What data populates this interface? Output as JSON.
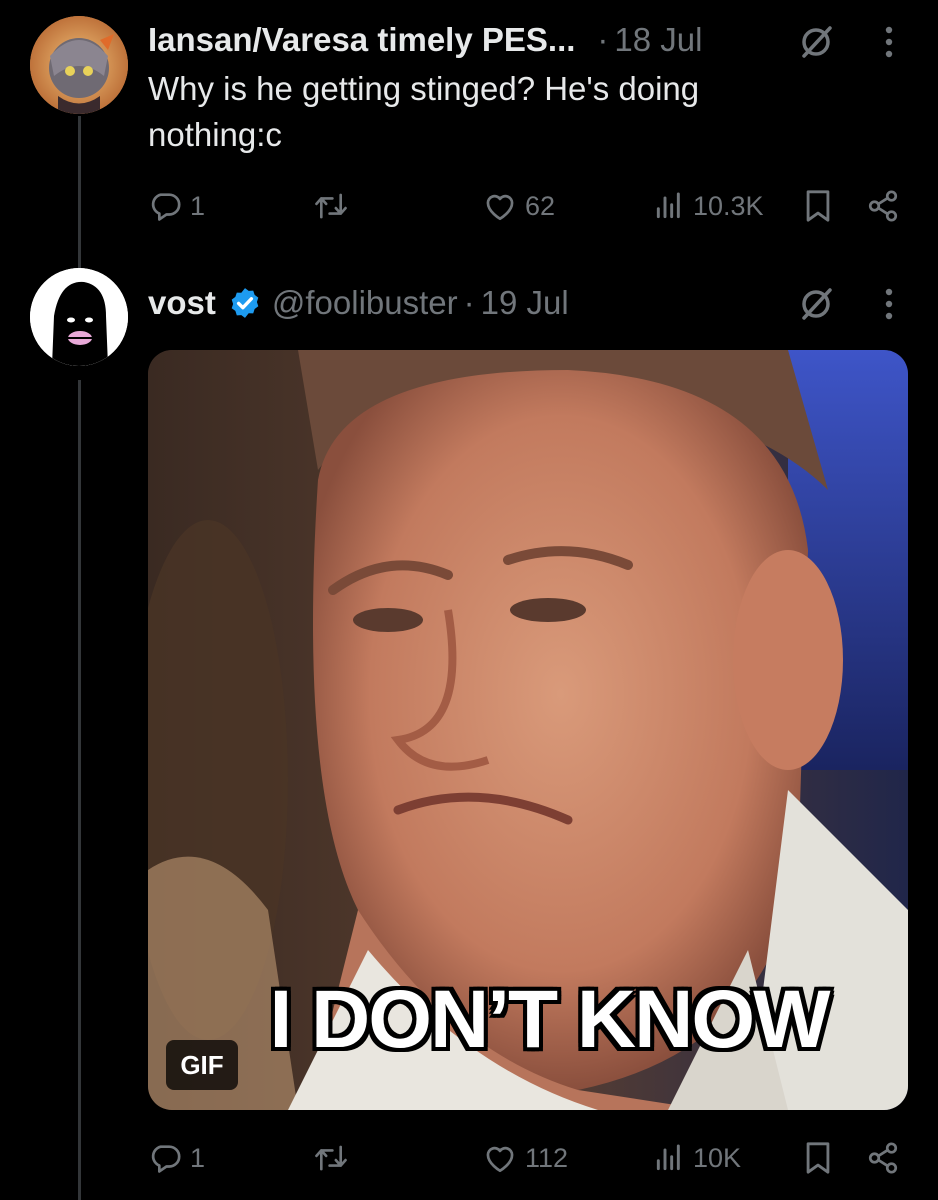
{
  "tweet1": {
    "author": "Iansan/Varesa timely PES...",
    "separator": "·",
    "date": "18 Jul",
    "text": "Why is he getting stinged? He's doing nothing:c",
    "replies": "1",
    "likes": "62",
    "views": "10.3K"
  },
  "tweet2": {
    "author": "vost",
    "handle": "@foolibuster",
    "separator": "·",
    "date": "19 Jul",
    "media": {
      "caption": "I DON’T KNOW",
      "badge": "GIF"
    },
    "replies": "1",
    "likes": "112",
    "views": "10K"
  },
  "colors": {
    "background": "#000000",
    "text": "#e7e9ea",
    "muted": "#71767b",
    "verified": "#1d9bf0"
  },
  "icons": [
    "grok-icon",
    "more-icon",
    "reply-icon",
    "retweet-icon",
    "like-icon",
    "views-icon",
    "bookmark-icon",
    "share-icon",
    "verified-badge-icon"
  ]
}
